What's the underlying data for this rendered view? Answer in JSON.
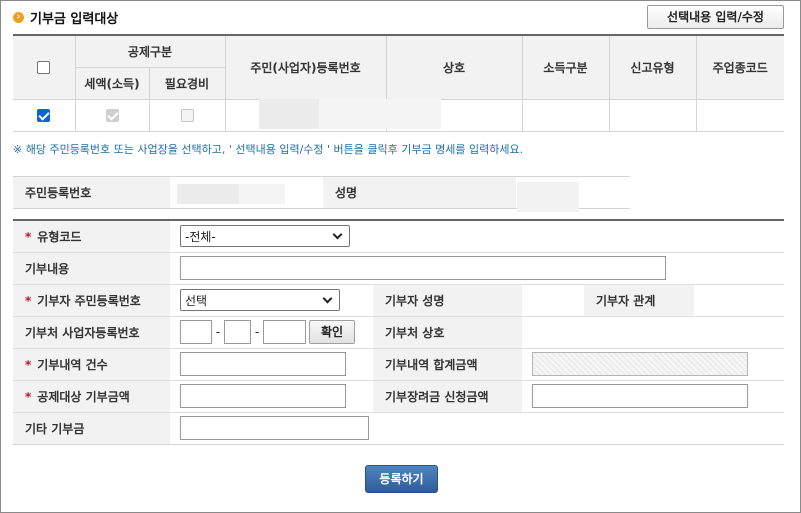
{
  "header": {
    "title": "기부금 입력대상",
    "edit_button": "선택내용 입력/수정"
  },
  "target_table": {
    "columns": {
      "deduction_group": "공제구분",
      "tax_credit": "세액(소득)",
      "necessary_expense": "필요경비",
      "reg_number": "주민(사업자)등록번호",
      "company_name": "상호",
      "income_type": "소득구분",
      "report_type": "신고유형",
      "business_code": "주업종코드"
    },
    "rows": [
      {
        "selected": true,
        "tax_credit": true,
        "necessary_expense": false
      }
    ]
  },
  "notice": "※ 해당 주민등록번호 또는 사업장을 선택하고, ' 선택내용 입력/수정 ' 버튼을 클릭후 기부금 명세를 입력하세요.",
  "info": {
    "reg_number_label": "주민등록번호",
    "name_label": "성명"
  },
  "form": {
    "type_code_label": "유형코드",
    "type_code_value": "-전체-",
    "content_label": "기부내용",
    "donor_reg_label": "기부자 주민등록번호",
    "donor_reg_value": "선택",
    "donor_name_label": "기부자 성명",
    "donor_relation_label": "기부자 관계",
    "recipient_biz_label": "기부처 사업자등록번호",
    "confirm_button": "확인",
    "recipient_name_label": "기부처 상호",
    "count_label": "기부내역 건수",
    "total_label": "기부내역 합계금액",
    "deduction_amount_label": "공제대상 기부금액",
    "scholarship_label": "기부장려금 신청금액",
    "other_label": "기타 기부금"
  },
  "submit_button": "등록하기",
  "colors": {
    "required": "#c8102e",
    "notice": "#1f6fa5",
    "submit_bg": "#3a6aa8",
    "checkbox_checked": "#0a66d6"
  }
}
